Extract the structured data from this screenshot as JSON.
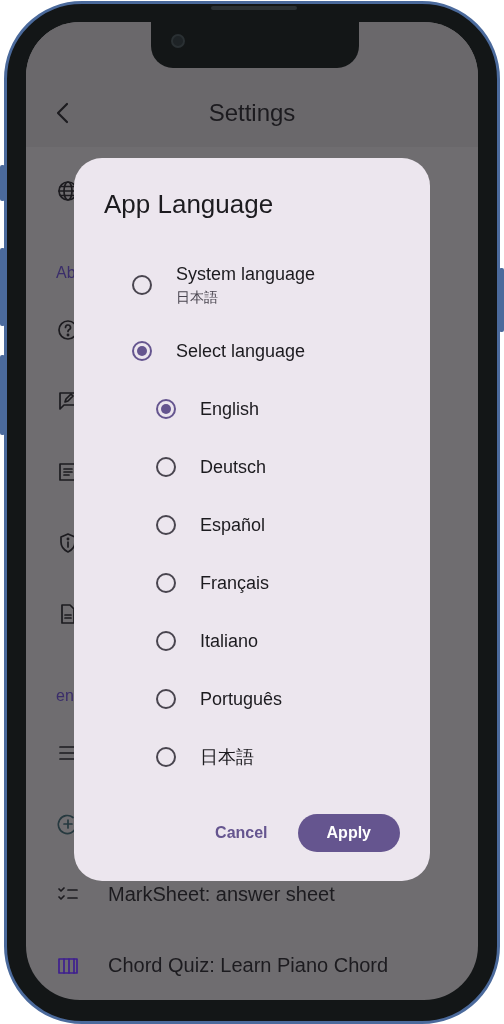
{
  "app_bar": {
    "title": "Settings"
  },
  "list": [
    {
      "kind": "globe"
    },
    {
      "kind": "header",
      "text": "Ab"
    },
    {
      "kind": "help"
    },
    {
      "kind": "feedback"
    },
    {
      "kind": "article"
    },
    {
      "kind": "privacy"
    },
    {
      "kind": "document"
    },
    {
      "kind": "header",
      "text": "en"
    },
    {
      "kind": "menu"
    },
    {
      "kind": "add"
    },
    {
      "kind": "checklist",
      "label": "MarkSheet: answer sheet"
    },
    {
      "kind": "piano",
      "label": "Chord Quiz: Learn Piano Chord"
    }
  ],
  "dialog": {
    "title": "App Language",
    "options": [
      {
        "label": "System language",
        "sublabel": "日本語",
        "selected": false
      },
      {
        "label": "Select language",
        "selected": true,
        "children": [
          {
            "label": "English",
            "selected": true
          },
          {
            "label": "Deutsch",
            "selected": false
          },
          {
            "label": "Español",
            "selected": false
          },
          {
            "label": "Français",
            "selected": false
          },
          {
            "label": "Italiano",
            "selected": false
          },
          {
            "label": "Português",
            "selected": false
          },
          {
            "label": "日本語",
            "selected": false
          }
        ]
      }
    ],
    "buttons": [
      {
        "kind": "text",
        "label": "Cancel"
      },
      {
        "kind": "filled",
        "label": "Apply"
      }
    ]
  }
}
